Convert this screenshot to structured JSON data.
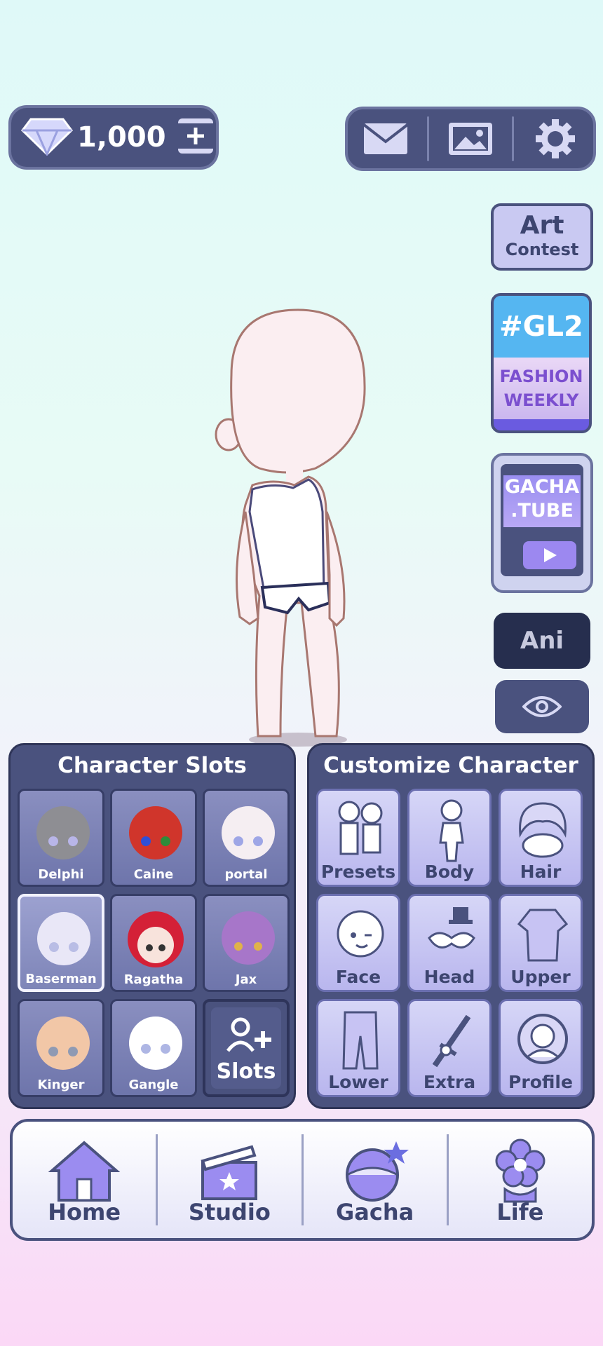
{
  "currency": {
    "amount": "1,000",
    "icon": "diamond-icon",
    "add_icon": "add-currency-icon"
  },
  "top_bar": {
    "icons": [
      "mail-icon",
      "gallery-icon",
      "settings-icon"
    ]
  },
  "side": {
    "art_contest": {
      "line1": "Art",
      "line2": "Contest"
    },
    "fashion_weekly": {
      "tag": "#GL2",
      "line1": "FASHION",
      "line2": "WEEKLY"
    },
    "gacha_tube": {
      "line1": "GACHA",
      "line2": ".TUBE"
    },
    "ani_label": "Ani",
    "eye_icon": "eye-icon"
  },
  "character_slots": {
    "title": "Character Slots",
    "slots": [
      {
        "name": "Delphi"
      },
      {
        "name": "Caine"
      },
      {
        "name": "portal"
      },
      {
        "name": "Baserman"
      },
      {
        "name": "Ragatha"
      },
      {
        "name": "Jax"
      },
      {
        "name": "Kinger"
      },
      {
        "name": "Gangle"
      }
    ],
    "add_label": "Slots",
    "selected": "Baserman"
  },
  "customize": {
    "title": "Customize Character",
    "items": [
      "Presets",
      "Body",
      "Hair",
      "Face",
      "Head",
      "Upper",
      "Lower",
      "Extra",
      "Profile"
    ]
  },
  "nav": {
    "items": [
      "Home",
      "Studio",
      "Gacha",
      "Life"
    ]
  },
  "colors": {
    "panel": "#4a527e",
    "accent": "#7b6cf0",
    "card": "#c9c6f3"
  }
}
